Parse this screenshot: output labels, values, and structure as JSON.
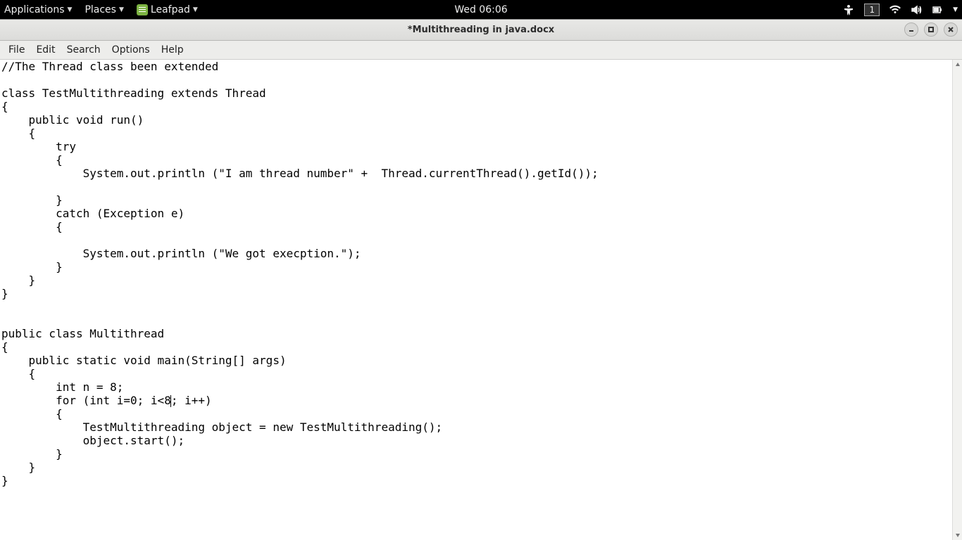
{
  "panel": {
    "applications": "Applications",
    "places": "Places",
    "app_name": "Leafpad",
    "clock": "Wed 06:06",
    "workspace": "1"
  },
  "window": {
    "title": "*Multithreading in java.docx"
  },
  "menubar": {
    "file": "File",
    "edit": "Edit",
    "search": "Search",
    "options": "Options",
    "help": "Help"
  },
  "editor": {
    "before_caret": "//The Thread class been extended \n\nclass TestMultithreading extends Thread \n{ \n    public void run() \n    { \n        try\n        { \n            System.out.println (\"I am thread number\" +  Thread.currentThread().getId()); \n  \n        } \n        catch (Exception e) \n        { \n\n            System.out.println (\"We got execption.\"); \n        } \n    } \n} \n\n\npublic class Multithread \n{ \n    public static void main(String[] args) \n    { \n        int n = 8;\n        for (int i=0; i<8",
    "after_caret": "; i++) \n        { \n            TestMultithreading object = new TestMultithreading(); \n            object.start(); \n        } \n    } \n} "
  }
}
